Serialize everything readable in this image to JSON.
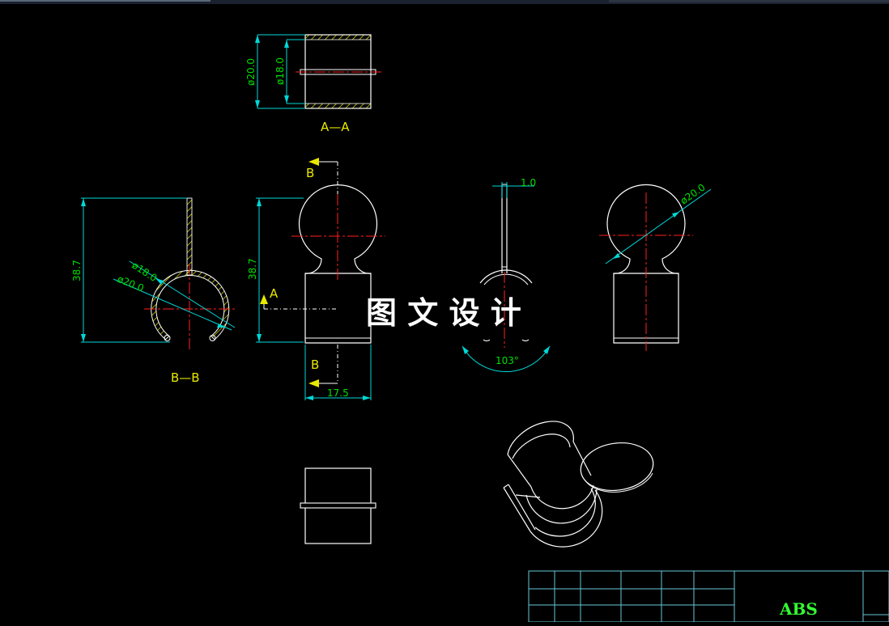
{
  "colors": {
    "background": "#000000",
    "outline": "#ffffff",
    "dimension": "#00d8d8",
    "dimension_text": "#00e000",
    "centerline": "#ff2020",
    "hatch": "#e8e800",
    "section_label": "#e8e800",
    "title_block": "#66c8d8",
    "material_text": "#33ff33"
  },
  "views": {
    "aa": {
      "dim_outer": "ø20.0",
      "dim_inner": "ø18.0",
      "label": "A—A"
    },
    "bb": {
      "dim_height": "38.7",
      "dim_inner": "ø18.0",
      "dim_outer": "ø20.0",
      "label": "B—B"
    },
    "front": {
      "dim_height": "38.7",
      "dim_width": "17.5",
      "arrow_a": "A",
      "arrow_b_top": "B",
      "arrow_b_bottom": "B"
    },
    "side": {
      "dim_thickness": "1.0",
      "dim_angle": "103°"
    },
    "right": {
      "dim_diameter": "ø20.0"
    }
  },
  "watermark": "图 文 设 计",
  "title_block": {
    "material": "ABS"
  }
}
